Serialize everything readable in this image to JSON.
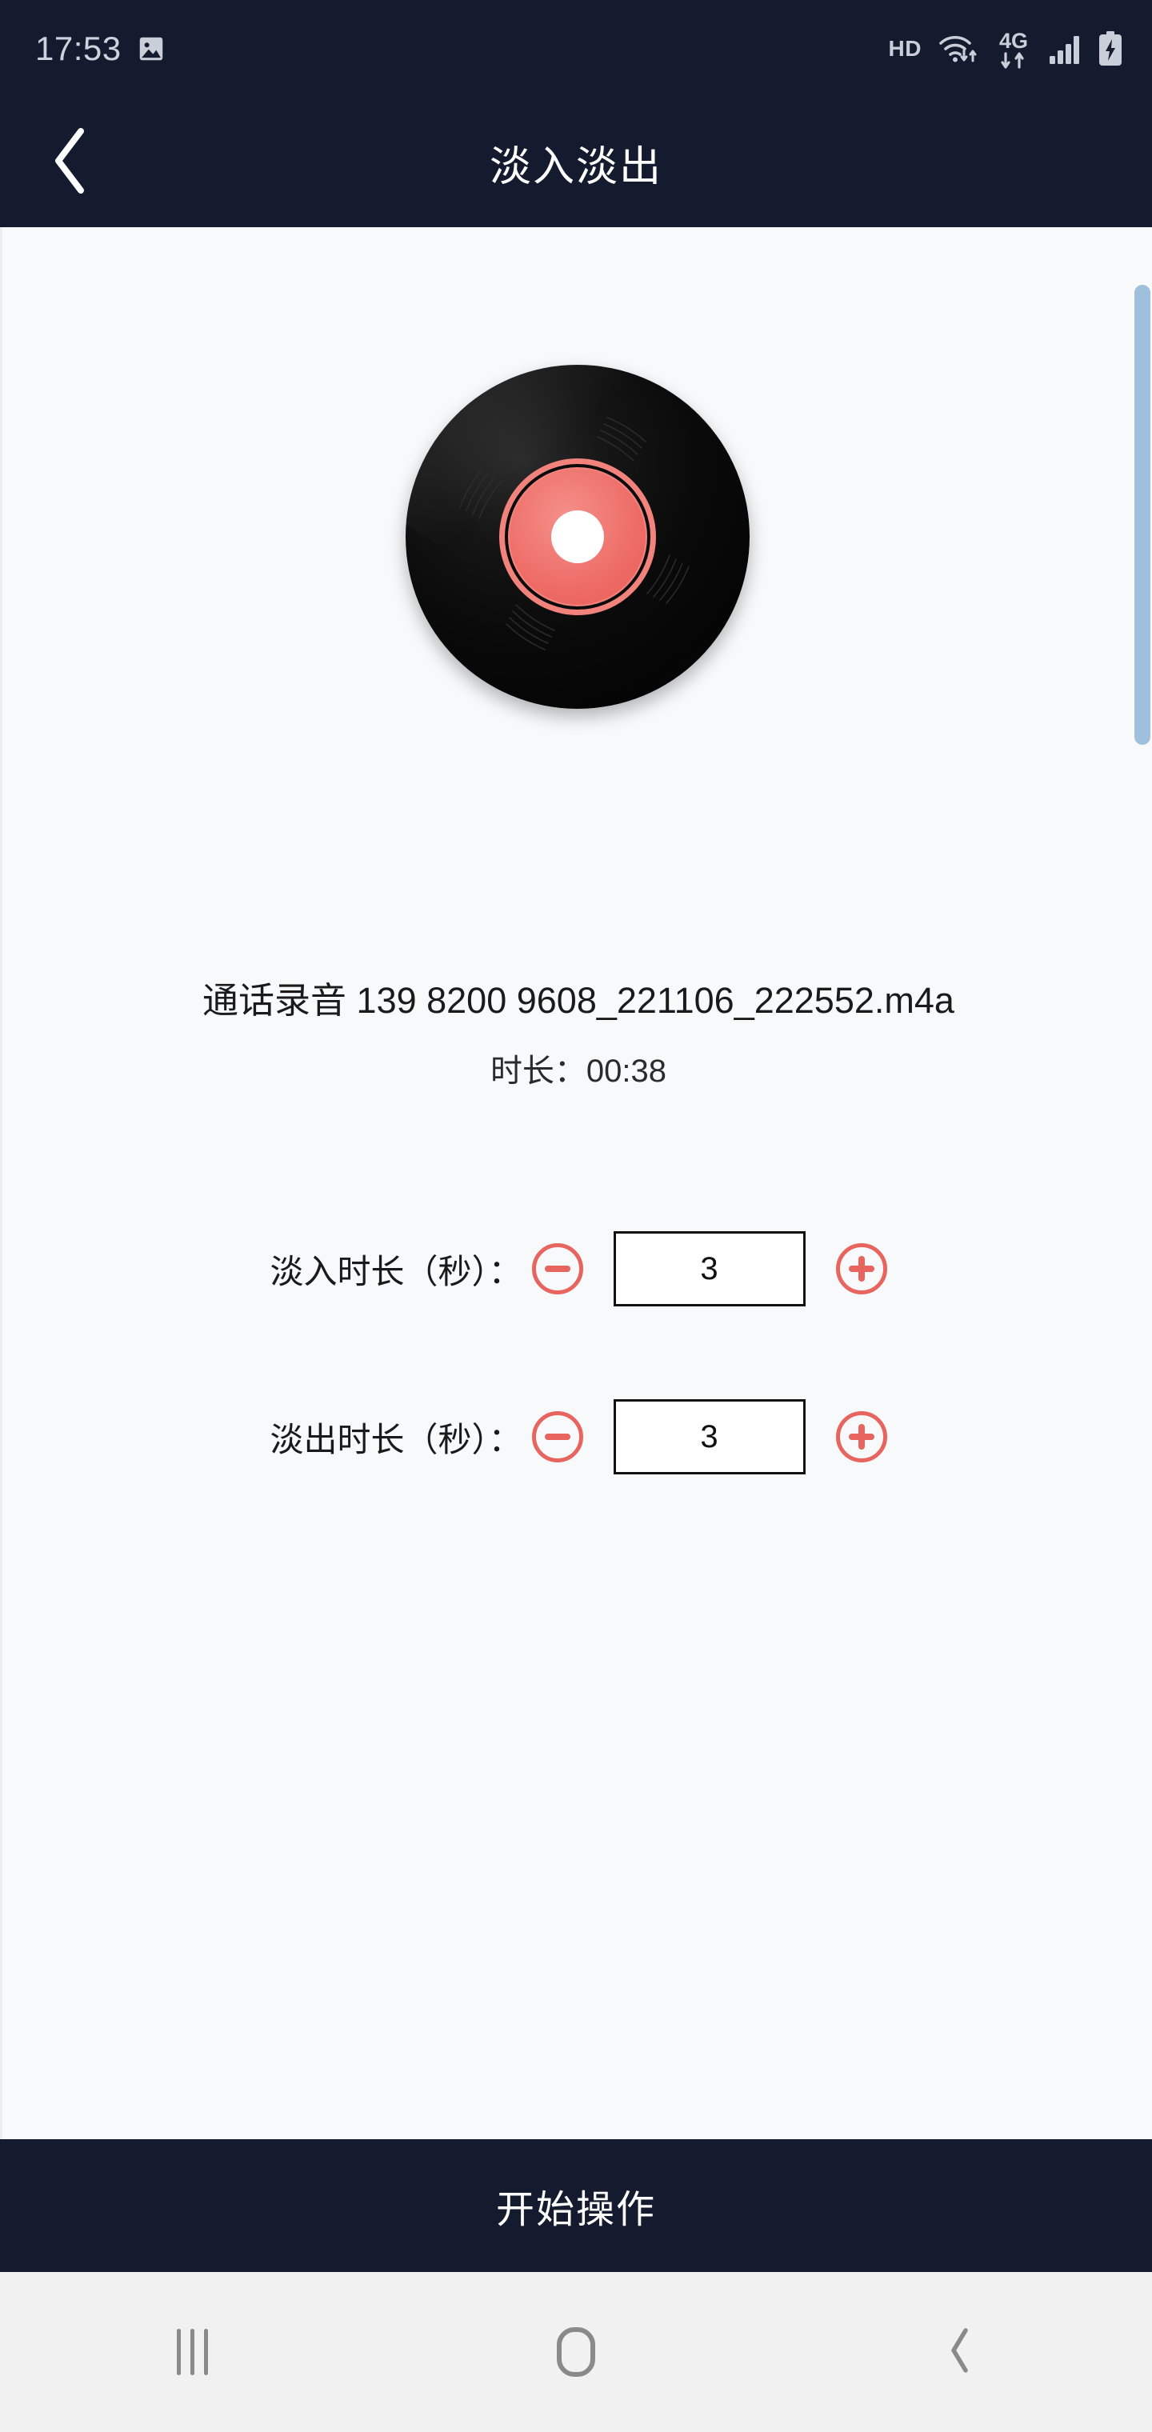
{
  "status_bar": {
    "time": "17:53",
    "gallery_icon": "image-icon",
    "hd_label": "HD",
    "wifi_icon": "wifi-icon",
    "network_label": "4G",
    "signal_icon": "signal-bars-icon",
    "battery_icon": "battery-charging-icon"
  },
  "header": {
    "back_icon": "chevron-left-icon",
    "title": "淡入淡出",
    "background_color": "#141b2e"
  },
  "media": {
    "record_icon": "vinyl-record-icon",
    "file_name": "通话录音 139 8200 9608_221106_222552.m4a",
    "duration_text": "时长：00:38",
    "label_color": "#ee6b66",
    "disc_color": "#000000"
  },
  "fields": [
    {
      "label": "淡入时长（秒）：",
      "value": "3",
      "decrement_icon": "minus-circle-icon",
      "increment_icon": "plus-circle-icon"
    },
    {
      "label": "淡出时长（秒）：",
      "value": "3",
      "decrement_icon": "minus-circle-icon",
      "increment_icon": "plus-circle-icon"
    }
  ],
  "action": {
    "label": "开始操作"
  },
  "nav_bar": {
    "recents_icon": "recents-icon",
    "home_icon": "home-icon",
    "back_icon": "chevron-left-icon"
  },
  "theme": {
    "accent_color": "#e8645e",
    "dark_color": "#141b2e",
    "content_background": "#f8f9fa",
    "scrollbar_color": "#9fc0dd"
  }
}
